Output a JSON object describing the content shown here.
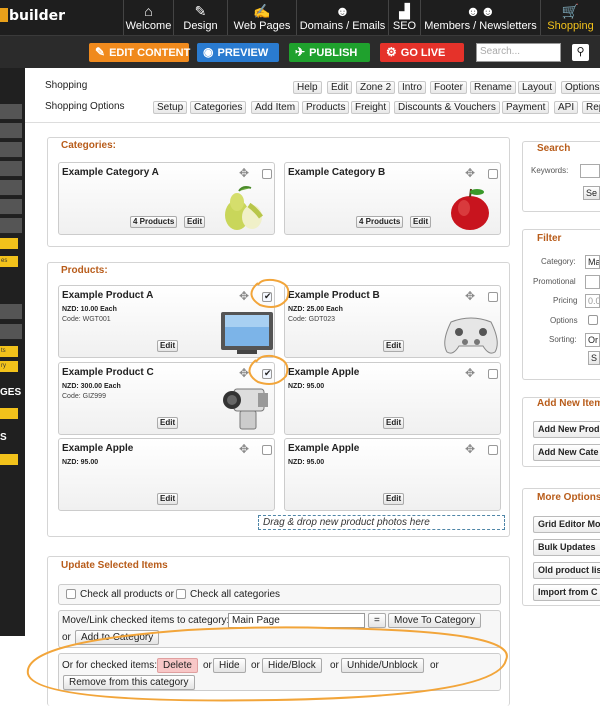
{
  "app": {
    "logo": "builder"
  },
  "nav": [
    {
      "label": "Welcome",
      "icon": "house-icon",
      "glyph": "⌂"
    },
    {
      "label": "Design",
      "icon": "brush-icon",
      "glyph": "✎"
    },
    {
      "label": "Web Pages",
      "icon": "page-edit-icon",
      "glyph": "✍"
    },
    {
      "label": "Domains / Emails",
      "icon": "people-icon",
      "glyph": "☻"
    },
    {
      "label": "SEO",
      "icon": "chart-icon",
      "glyph": "▟"
    },
    {
      "label": "Members / Newsletters",
      "icon": "group-icon",
      "glyph": "☻☻"
    },
    {
      "label": "Shopping",
      "icon": "cart-icon",
      "glyph": "🛒"
    }
  ],
  "actions": {
    "edit": "EDIT CONTENT",
    "preview": "PREVIEW",
    "publish": "PUBLISH",
    "golive": "GO LIVE",
    "search_placeholder": "Search...",
    "colors": {
      "edit": "#f08a1d",
      "preview": "#2a7bd0",
      "publish": "#1fa12d",
      "golive": "#e5322a"
    }
  },
  "sidebar": {
    "text_ges": "GES",
    "text_s": "S",
    "y1": "es",
    "y2": "ts",
    "y3": "ry"
  },
  "toolbar1": {
    "title": "Shopping",
    "buttons": [
      "Help",
      "Edit",
      "Zone 2",
      "Intro",
      "Footer",
      "Rename",
      "Layout",
      "Options"
    ]
  },
  "toolbar2": {
    "title": "Shopping Options",
    "buttons": [
      "Setup",
      "Categories",
      "Add Item",
      "Products",
      "Freight",
      "Discounts & Vouchers",
      "Payment",
      "API",
      "Rep"
    ]
  },
  "categories": {
    "title": "Categories:",
    "items": [
      {
        "name": "Example Category A",
        "count": "4 Products",
        "edit": "Edit"
      },
      {
        "name": "Example Category B",
        "count": "4 Products",
        "edit": "Edit"
      }
    ]
  },
  "products": {
    "title": "Products:",
    "items": [
      {
        "name": "Example Product A",
        "price": "NZD: 10.00 Each",
        "code": "Code: WGT001",
        "edit": "Edit",
        "checked": true
      },
      {
        "name": "Example Product B",
        "price": "NZD: 25.00 Each",
        "code": "Code: GDT023",
        "edit": "Edit",
        "checked": false
      },
      {
        "name": "Example Product C",
        "price": "NZD: 300.00 Each",
        "code": "Code: GIZ999",
        "edit": "Edit",
        "checked": true
      },
      {
        "name": "Example Apple",
        "price": "NZD: 95.00",
        "code": "",
        "edit": "Edit",
        "checked": false
      },
      {
        "name": "Example Apple",
        "price": "NZD: 95.00",
        "code": "",
        "edit": "Edit",
        "checked": false
      },
      {
        "name": "Example Apple",
        "price": "NZD: 95.00",
        "code": "",
        "edit": "Edit",
        "checked": false
      }
    ],
    "dropzone": "Drag & drop new product photos here"
  },
  "update": {
    "title": "Update Selected Items",
    "check_all_products": "Check all products or",
    "check_all_categories": "Check all categories",
    "move_label": "Move/Link checked items to category:",
    "move_value": "Main Page",
    "eq": "=",
    "move_btn": "Move To Category",
    "or": "or",
    "add_btn": "Add to Category",
    "or_checked": "Or for checked items:",
    "delete": "Delete",
    "hide": "Hide",
    "hide_block": "Hide/Block",
    "unhide": "Unhide/Unblock",
    "remove": "Remove from this category"
  },
  "right": {
    "search": {
      "title": "Search",
      "keywords": "Keywords:",
      "btn": "Se"
    },
    "filter": {
      "title": "Filter",
      "category": "Category:",
      "category_val": "Ma",
      "promotional": "Promotional",
      "pricing": "Pricing",
      "pricing_val": "0.0",
      "options": "Options",
      "sorting": "Sorting:",
      "sorting_val": "Or",
      "btn": "S"
    },
    "add_new": {
      "title": "Add New Item",
      "btn1": "Add New Prod",
      "btn2": "Add New Cate"
    },
    "more": {
      "title": "More Options",
      "btns": [
        "Grid Editor Mo",
        "Bulk Updates",
        "Old product lis",
        "Import from C"
      ]
    }
  }
}
